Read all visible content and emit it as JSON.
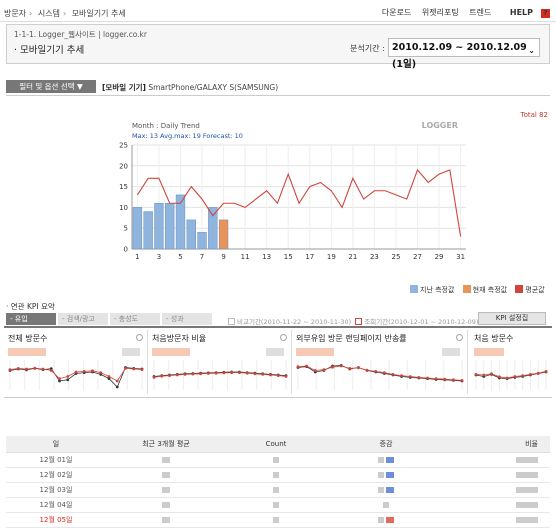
{
  "breadcrumb": [
    "방문자",
    "시스템",
    "모바일기기 추세"
  ],
  "top_links": [
    "다운로드",
    "위젯리포팅",
    "트렌드",
    "HELP"
  ],
  "site_link": "1-1-1. Logger_웹사이트 | logger.co.kr",
  "page_title": "· 모바일기기 추세",
  "date_label": "분석기간 :",
  "date_range": "2010.12.09 ~ 2010.12.09 (1일)",
  "filter": {
    "button_label": "필터 및 옵션 선택 ▼",
    "selected_label": "[모바일 기기]",
    "selected_value": "SmartPhone/GALAXY S(SAMSUNG)"
  },
  "total_text": "Total 82",
  "chart_data": {
    "type": "bar",
    "title": "Month : Daily Trend",
    "stats_text": "Max: 13   Avg.max: 19   Forecast: 10",
    "watermark": "LOGGER",
    "x_ticks": [
      "1",
      "3",
      "5",
      "7",
      "9",
      "11",
      "13",
      "15",
      "17",
      "19",
      "21",
      "23",
      "25",
      "27",
      "29",
      "31"
    ],
    "y_ticks": [
      "0",
      "5",
      "10",
      "15",
      "20",
      "25"
    ],
    "ylim": [
      0,
      25
    ],
    "categories": [
      1,
      2,
      3,
      4,
      5,
      6,
      7,
      8,
      9,
      10,
      11,
      12,
      13,
      14,
      15,
      16,
      17,
      18,
      19,
      20,
      21,
      22,
      23,
      24,
      25,
      26,
      27,
      28,
      29,
      30,
      31
    ],
    "series": [
      {
        "name": "지난 측정값",
        "kind": "bar",
        "color": "#8fb4dd",
        "values": [
          10,
          9,
          11,
          11,
          13,
          7,
          4,
          10,
          null
        ]
      },
      {
        "name": "현재 측정값",
        "kind": "bar",
        "color": "#e8935a",
        "values": [
          null,
          null,
          null,
          null,
          null,
          null,
          null,
          null,
          7
        ]
      },
      {
        "name": "평균값",
        "kind": "line",
        "color": "#d0453c",
        "values": [
          13,
          17,
          17,
          11,
          11,
          15,
          12,
          8,
          11,
          11,
          10,
          12,
          14,
          11,
          18,
          11,
          15,
          16,
          14,
          10,
          17,
          12,
          14,
          14,
          13,
          12,
          19,
          16,
          18,
          19,
          3
        ]
      }
    ],
    "grid": true,
    "legend": "bottom-right"
  },
  "kpi": {
    "title": "· 연관 KPI 요약",
    "tabs": [
      "- 유입",
      "- 검색/광고",
      "- 충성도",
      "- 성과"
    ],
    "period_compare": "비교기간(2010-11-22 ~ 2010-11-30)",
    "period_view": "조회기간(2010-12-01 ~ 2010-12-09)",
    "settings_button": "KPI 설정집",
    "cards": [
      "전체 방문수",
      "처음방문자 비율",
      "외부유입 방문 랜딩페이지 반송률",
      "처음 방문수"
    ]
  },
  "table": {
    "headers": [
      "일",
      "최근 3개월 평균",
      "Count",
      "증감",
      "비율"
    ],
    "rows": [
      "12월 01일",
      "12월 02일",
      "12월 03일",
      "12월 04일",
      "12월 05일"
    ]
  }
}
